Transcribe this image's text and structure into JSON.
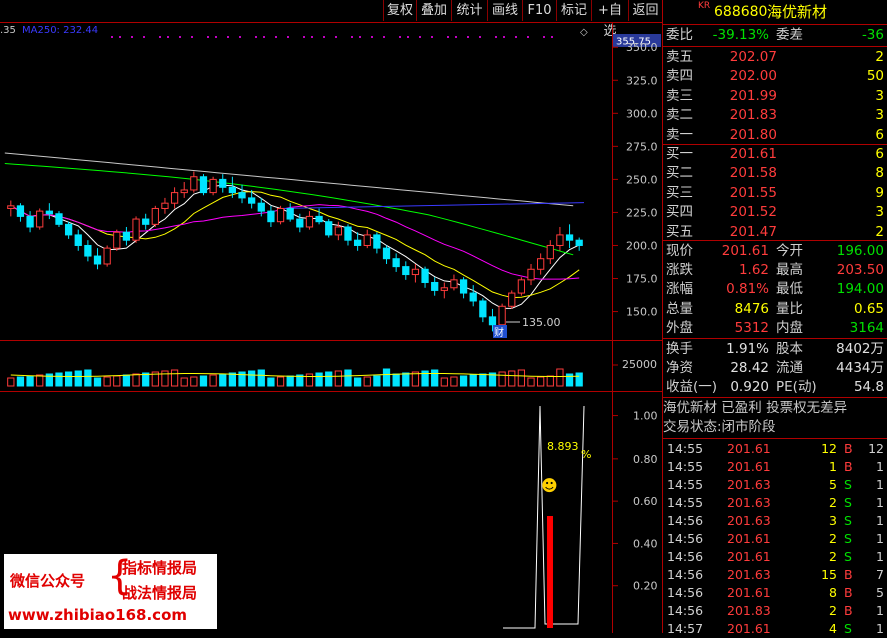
{
  "toolbar": {
    "buttons": [
      "复权",
      "叠加",
      "统计",
      "画线",
      "F10",
      "标记",
      "+自选",
      "返回"
    ]
  },
  "chart": {
    "ma_label_prefix": ".35",
    "ma_label": "MA250: 232.44",
    "current_price_tag": "355.75",
    "price_axis": [
      "350.0",
      "325.0",
      "300.0",
      "275.0",
      "250.0",
      "225.0",
      "200.0",
      "175.0",
      "150.0"
    ],
    "low_annotation": "135.00",
    "finance_badge": "财",
    "volume_axis": "25000",
    "indicator_axis": [
      "1.00",
      "0.80",
      "0.60",
      "0.40",
      "0.20"
    ],
    "indicator_value": "8.893",
    "indicator_unit": "%",
    "smiley": "☻"
  },
  "chart_data": {
    "type": "candlestick",
    "ylim": [
      130,
      360
    ],
    "candles": [
      [
        228,
        234,
        222,
        230
      ],
      [
        230,
        232,
        218,
        222
      ],
      [
        222,
        226,
        210,
        214
      ],
      [
        214,
        228,
        212,
        226
      ],
      [
        226,
        232,
        220,
        224
      ],
      [
        224,
        226,
        214,
        216
      ],
      [
        216,
        218,
        205,
        208
      ],
      [
        208,
        212,
        196,
        200
      ],
      [
        200,
        204,
        188,
        192
      ],
      [
        192,
        198,
        182,
        186
      ],
      [
        186,
        200,
        184,
        198
      ],
      [
        198,
        212,
        196,
        210
      ],
      [
        210,
        214,
        200,
        204
      ],
      [
        204,
        222,
        202,
        220
      ],
      [
        220,
        224,
        212,
        216
      ],
      [
        216,
        230,
        214,
        228
      ],
      [
        228,
        236,
        224,
        232
      ],
      [
        232,
        244,
        228,
        240
      ],
      [
        240,
        248,
        236,
        242
      ],
      [
        242,
        256,
        240,
        252
      ],
      [
        252,
        254,
        238,
        240
      ],
      [
        240,
        252,
        238,
        250
      ],
      [
        250,
        254,
        240,
        244
      ],
      [
        244,
        252,
        236,
        240
      ],
      [
        240,
        246,
        232,
        236
      ],
      [
        236,
        242,
        228,
        232
      ],
      [
        232,
        236,
        222,
        226
      ],
      [
        226,
        230,
        214,
        218
      ],
      [
        218,
        230,
        216,
        228
      ],
      [
        228,
        232,
        218,
        220
      ],
      [
        220,
        224,
        210,
        214
      ],
      [
        214,
        226,
        212,
        222
      ],
      [
        222,
        228,
        216,
        218
      ],
      [
        218,
        220,
        206,
        208
      ],
      [
        208,
        218,
        204,
        214
      ],
      [
        214,
        216,
        200,
        204
      ],
      [
        204,
        210,
        196,
        200
      ],
      [
        200,
        212,
        198,
        208
      ],
      [
        208,
        210,
        194,
        198
      ],
      [
        198,
        200,
        186,
        190
      ],
      [
        190,
        194,
        180,
        184
      ],
      [
        184,
        188,
        174,
        178
      ],
      [
        178,
        186,
        172,
        182
      ],
      [
        182,
        184,
        168,
        172
      ],
      [
        172,
        176,
        162,
        166
      ],
      [
        166,
        172,
        160,
        168
      ],
      [
        168,
        178,
        166,
        174
      ],
      [
        174,
        176,
        160,
        164
      ],
      [
        164,
        170,
        154,
        158
      ],
      [
        158,
        160,
        142,
        146
      ],
      [
        146,
        152,
        135,
        140
      ],
      [
        140,
        156,
        138,
        154
      ],
      [
        154,
        166,
        152,
        164
      ],
      [
        164,
        176,
        162,
        174
      ],
      [
        174,
        186,
        170,
        182
      ],
      [
        182,
        194,
        178,
        190
      ],
      [
        190,
        204,
        186,
        200
      ],
      [
        200,
        214,
        196,
        208
      ],
      [
        208,
        216,
        198,
        204
      ],
      [
        204,
        206,
        196,
        200
      ]
    ],
    "ma250": 232.44,
    "low": 135.0,
    "indicator": {
      "value": 8.893,
      "ylim": [
        0,
        1.05
      ]
    }
  },
  "quote": {
    "market_tag": "KR",
    "code": "688680",
    "name": "海优新材",
    "weibi_label": "委比",
    "weibi": "-39.13%",
    "weicha_label": "委差",
    "weicha": "-36",
    "asks": [
      {
        "label": "卖五",
        "price": "202.07",
        "vol": "2"
      },
      {
        "label": "卖四",
        "price": "202.00",
        "vol": "50"
      },
      {
        "label": "卖三",
        "price": "201.99",
        "vol": "3"
      },
      {
        "label": "卖二",
        "price": "201.83",
        "vol": "3"
      },
      {
        "label": "卖一",
        "price": "201.80",
        "vol": "6"
      }
    ],
    "bids": [
      {
        "label": "买一",
        "price": "201.61",
        "vol": "6"
      },
      {
        "label": "买二",
        "price": "201.58",
        "vol": "8"
      },
      {
        "label": "买三",
        "price": "201.55",
        "vol": "9"
      },
      {
        "label": "买四",
        "price": "201.52",
        "vol": "3"
      },
      {
        "label": "买五",
        "price": "201.47",
        "vol": "2"
      }
    ],
    "stats": [
      {
        "l1": "现价",
        "v1": "201.61",
        "c1": "red",
        "l2": "今开",
        "v2": "196.00",
        "c2": "green"
      },
      {
        "l1": "涨跌",
        "v1": "1.62",
        "c1": "red",
        "l2": "最高",
        "v2": "203.50",
        "c2": "red"
      },
      {
        "l1": "涨幅",
        "v1": "0.81%",
        "c1": "red",
        "l2": "最低",
        "v2": "194.00",
        "c2": "green"
      },
      {
        "l1": "总量",
        "v1": "8476",
        "c1": "yellow",
        "l2": "量比",
        "v2": "0.65",
        "c2": "yellow"
      },
      {
        "l1": "外盘",
        "v1": "5312",
        "c1": "red",
        "l2": "内盘",
        "v2": "3164",
        "c2": "green"
      }
    ],
    "stats2": [
      {
        "l1": "换手",
        "v1": "1.91%",
        "l2": "股本",
        "v2": "8402万"
      },
      {
        "l1": "净资",
        "v1": "28.42",
        "l2": "流通",
        "v2": "4434万"
      },
      {
        "l1": "收益(一)",
        "v1": "0.920",
        "l2": "PE(动)",
        "v2": "54.8"
      }
    ],
    "info_line": "海优新材 已盈利 投票权无差异",
    "status_line": "交易状态:闭市阶段"
  },
  "ticks": [
    {
      "time": "14:55",
      "price": "201.61",
      "vol": "12",
      "bs": "B",
      "n": "12"
    },
    {
      "time": "14:55",
      "price": "201.61",
      "vol": "1",
      "bs": "B",
      "n": "1"
    },
    {
      "time": "14:55",
      "price": "201.63",
      "vol": "5",
      "bs": "S",
      "n": "1"
    },
    {
      "time": "14:55",
      "price": "201.63",
      "vol": "2",
      "bs": "S",
      "n": "1"
    },
    {
      "time": "14:56",
      "price": "201.63",
      "vol": "3",
      "bs": "S",
      "n": "1"
    },
    {
      "time": "14:56",
      "price": "201.61",
      "vol": "2",
      "bs": "S",
      "n": "1"
    },
    {
      "time": "14:56",
      "price": "201.61",
      "vol": "2",
      "bs": "S",
      "n": "1"
    },
    {
      "time": "14:56",
      "price": "201.63",
      "vol": "15",
      "bs": "B",
      "n": "7"
    },
    {
      "time": "14:56",
      "price": "201.61",
      "vol": "8",
      "bs": "B",
      "n": "5"
    },
    {
      "time": "14:56",
      "price": "201.83",
      "vol": "2",
      "bs": "B",
      "n": "1"
    },
    {
      "time": "14:57",
      "price": "201.61",
      "vol": "4",
      "bs": "S",
      "n": "1"
    }
  ],
  "watermark": {
    "left": "微信公众号",
    "brace": "{",
    "line1": "指标情报局",
    "line2": "战法情报局",
    "url": "www.zhibiao168.com"
  },
  "colors": {
    "up": "#ff3c3c",
    "down": "#00e5ff",
    "ma5": "#ffffff",
    "ma10": "#ffff00",
    "ma20": "#ff00ff",
    "ma60": "#00ff00",
    "ma120": "#c8c8c8",
    "ma250": "#3a3aff"
  }
}
